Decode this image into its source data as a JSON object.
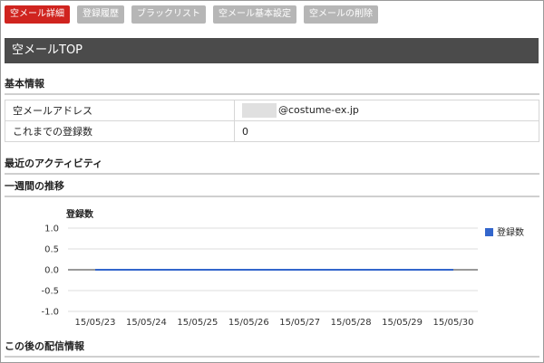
{
  "tabs": [
    {
      "label": "空メール詳細",
      "active": true
    },
    {
      "label": "登録履歴",
      "active": false
    },
    {
      "label": "ブラックリスト",
      "active": false
    },
    {
      "label": "空メール基本設定",
      "active": false
    },
    {
      "label": "空メールの削除",
      "active": false
    }
  ],
  "page_title": "空メールTOP",
  "sections": {
    "basic_info": "基本情報",
    "recent_activity": "最近のアクティビティ",
    "weekly_trend": "一週間の推移",
    "delivery_info": "この後の配信情報"
  },
  "info_table": {
    "rows": [
      {
        "label": "空メールアドレス",
        "value": "@costume-ex.jp"
      },
      {
        "label": "これまでの登録数",
        "value": "0"
      }
    ]
  },
  "colors": {
    "active_tab": "#d0241f",
    "inactive_tab": "#b6b6b6",
    "header_bar": "#4b4b4b",
    "series": "#3366cc"
  },
  "chart_data": {
    "type": "line",
    "title": "登録数",
    "x": [
      "15/05/23",
      "15/05/24",
      "15/05/25",
      "15/05/26",
      "15/05/27",
      "15/05/28",
      "15/05/29",
      "15/05/30"
    ],
    "series": [
      {
        "name": "登録数",
        "values": [
          0,
          0,
          0,
          0,
          0,
          0,
          0,
          0
        ]
      }
    ],
    "yticks": [
      "1.0",
      "0.5",
      "0.0",
      "-0.5",
      "-1.0"
    ],
    "ylim": [
      -1.0,
      1.0
    ],
    "grid": true,
    "legend": "right"
  }
}
